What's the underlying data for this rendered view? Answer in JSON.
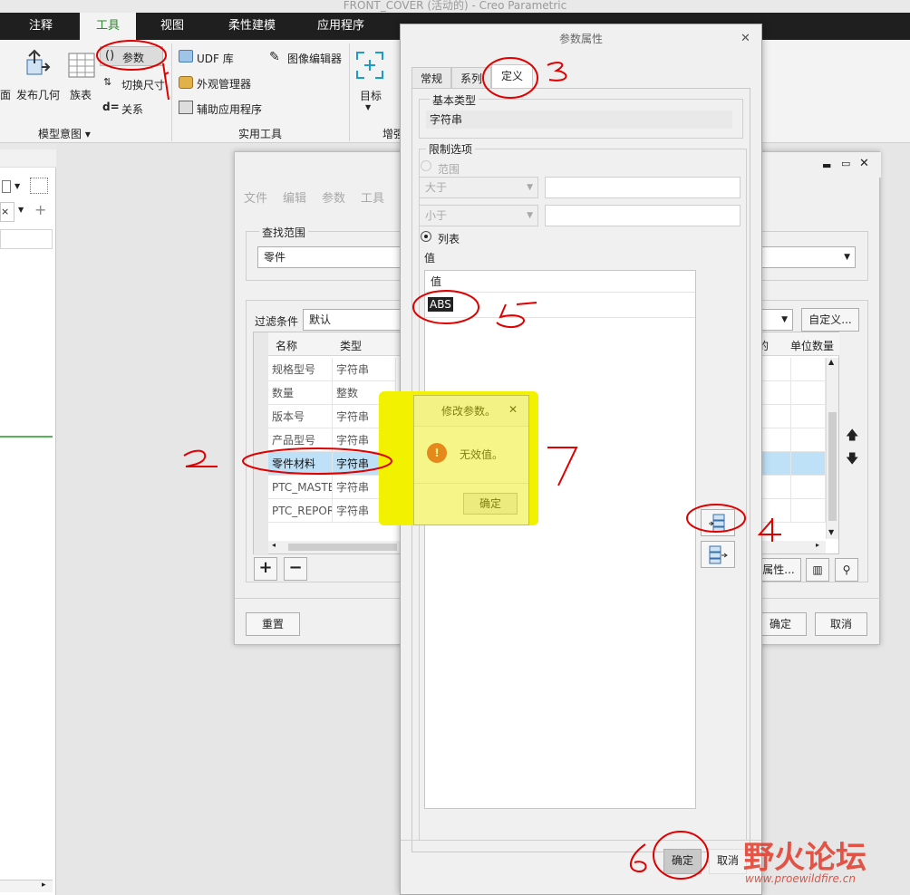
{
  "window": {
    "title": "FRONT_COVER (活动的) - Creo Parametric"
  },
  "ribbon_tabs": [
    "注释",
    "工具",
    "视图",
    "柔性建模",
    "应用程序"
  ],
  "ribbon": {
    "items": {
      "face": "面",
      "publish_geometry": "发布几何",
      "family_table": "族表",
      "parameters": "参数",
      "switch_dims": "切换尺寸",
      "relations": "关系",
      "udf_library": "UDF 库",
      "appearance_manager": "外观管理器",
      "auxiliary_apps": "辅助应用程序",
      "image_editor": "图像编辑器",
      "target": "目标"
    },
    "groups": {
      "model_intent": "模型意图",
      "utilities": "实用工具",
      "enhance": "增强"
    }
  },
  "param_dialog": {
    "menu": [
      "文件",
      "编辑",
      "参数",
      "工具"
    ],
    "lookin_label": "查找范围",
    "lookin_value": "零件",
    "filter_label": "过滤条件",
    "filter_value": "默认",
    "customize_button": "自定义...",
    "columns": {
      "name": "名称",
      "type": "类型",
      "designated": "的",
      "unit_quantity": "单位数量"
    },
    "rows": [
      {
        "name": "规格型号",
        "type": "字符串"
      },
      {
        "name": "数量",
        "type": "整数"
      },
      {
        "name": "版本号",
        "type": "字符串"
      },
      {
        "name": "产品型号",
        "type": "字符串"
      },
      {
        "name": "零件材料",
        "type": "字符串",
        "selected": true
      },
      {
        "name": "PTC_MASTE",
        "type": "字符串"
      },
      {
        "name": "PTC_REPOR",
        "type": "字符串"
      }
    ],
    "props_button": "属性...",
    "reset_button": "重置",
    "ok_button": "确定",
    "cancel_button": "取消"
  },
  "prop_dialog": {
    "title": "参数属性",
    "tabs": [
      "常规",
      "系列",
      "定义"
    ],
    "base_type_label": "基本类型",
    "base_type_value": "字符串",
    "restriction_label": "限制选项",
    "range_label": "范围",
    "greater_than": "大于",
    "less_than": "小于",
    "list_label": "列表",
    "values_label": "值",
    "values_header": "值",
    "values": [
      "ABS"
    ],
    "ok_button": "确定",
    "cancel_button": "取消"
  },
  "popup": {
    "title": "修改参数。",
    "message": "无效值。",
    "ok_button": "确定"
  },
  "annotations": [
    "1",
    "2",
    "3",
    "4",
    "5",
    "6",
    "7"
  ],
  "watermark": {
    "brand": "野火论坛",
    "url": "www.proewildfire.cn"
  },
  "colors": {
    "accent_green": "#2b8a2b",
    "selection_blue": "#bfe1f7",
    "highlight": "#f2f200",
    "annotation_red": "#e00000",
    "warning_red": "#d33",
    "watermark_red": "#e23a2a"
  }
}
